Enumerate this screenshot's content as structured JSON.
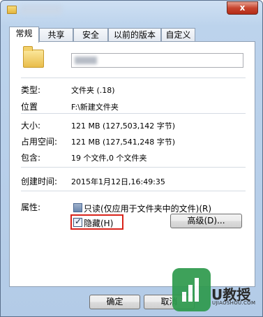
{
  "window": {
    "close_glyph": "x"
  },
  "tabs": [
    {
      "label": "常规",
      "active": true
    },
    {
      "label": "共享",
      "active": false
    },
    {
      "label": "安全",
      "active": false
    },
    {
      "label": "以前的版本",
      "active": false
    },
    {
      "label": "自定义",
      "active": false
    }
  ],
  "general": {
    "type_label": "类型:",
    "type_value": "文件夹 (.18)",
    "location_label": "位置",
    "location_value": "F:\\新建文件夹",
    "size_label": "大小:",
    "size_value": "121 MB (127,503,142 字节)",
    "disk_size_label": "占用空间:",
    "disk_size_value": "121 MB (127,541,248 字节)",
    "contains_label": "包含:",
    "contains_value": "19 个文件,0 个文件夹",
    "created_label": "创建时间:",
    "created_value": "2015年1月12日,16:49:35",
    "attributes_label": "属性:",
    "readonly_label": "只读(仅应用于文件夹中的文件)(R)",
    "readonly_state": "indeterminate",
    "hidden_label": "隐藏(H)",
    "hidden_checked": true,
    "advanced_button": "高级(D)..."
  },
  "buttons": {
    "ok": "确定",
    "cancel": "取消"
  },
  "watermark": {
    "text": "U教授",
    "sub": "UJIAOSHOU.COM",
    "color": "#2e9a4d"
  },
  "colors": {
    "highlight_box": "#d8231a",
    "close_button": "#c7452f"
  }
}
